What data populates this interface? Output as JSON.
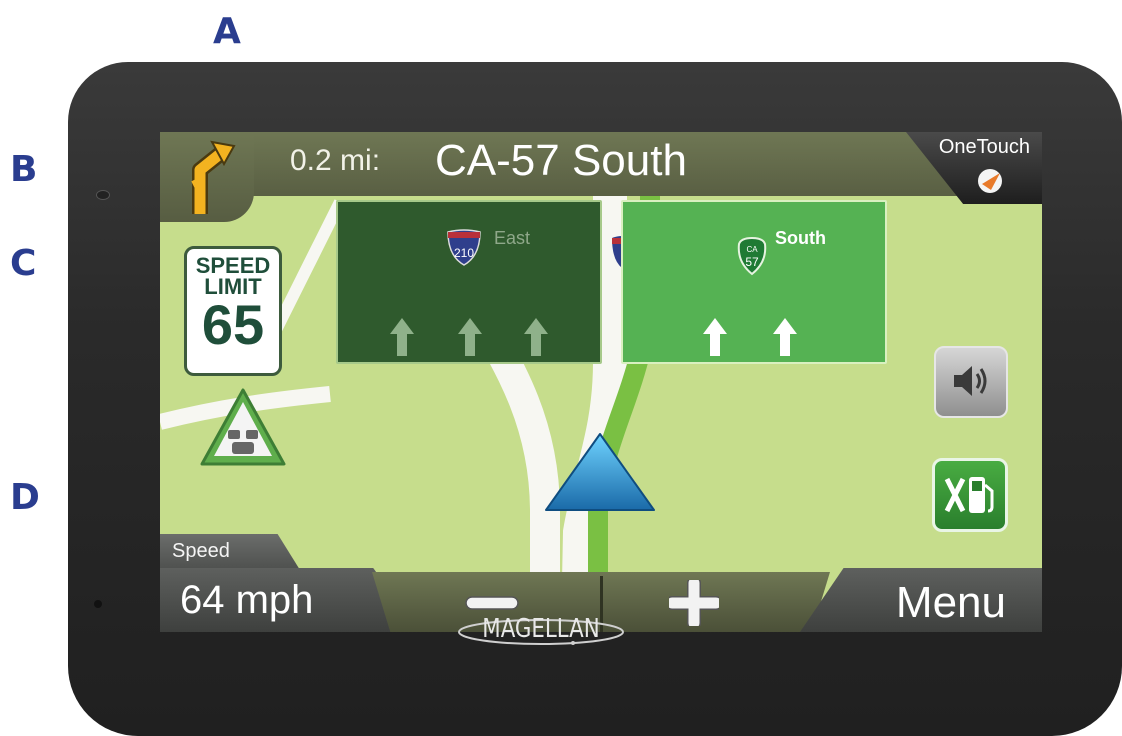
{
  "callouts": [
    "A",
    "B",
    "C",
    "D"
  ],
  "top_bar": {
    "turn_icon": "bear-right-icon",
    "distance": "0.2 mi:",
    "street": "CA-57 South",
    "onetouch_label": "OneTouch",
    "onetouch_icon": "navigation-arrow-icon"
  },
  "signs": [
    {
      "route_number": "210",
      "route_icon": "interstate-shield-icon",
      "direction": "East",
      "arrows": 3,
      "active": false
    },
    {
      "route_state": "CA",
      "route_number": "57",
      "route_icon": "state-route-shield-icon",
      "direction": "South",
      "arrows": 2,
      "active": true
    }
  ],
  "speed_limit": {
    "label_line1": "SPEED",
    "label_line2": "LIMIT",
    "value": "65"
  },
  "traffic_icon": "traffic-warning-icon",
  "volume_icon": "speaker-icon",
  "gas_icon": "fuel-pump-icon",
  "vehicle_icon": "vehicle-position-arrow-icon",
  "bottom_bar": {
    "speed_label": "Speed",
    "speed_value": "64 mph",
    "zoom_out_icon": "minus-icon",
    "zoom_in_icon": "plus-icon",
    "menu_label": "Menu"
  },
  "brand": "MAGELLAN",
  "colors": {
    "callout": "#2a3d8f",
    "map": "#c6dd8c",
    "sign_inactive": "#2f5a2d",
    "sign_active": "#55b253",
    "vehicle_arrow": "#2a8ccc"
  }
}
